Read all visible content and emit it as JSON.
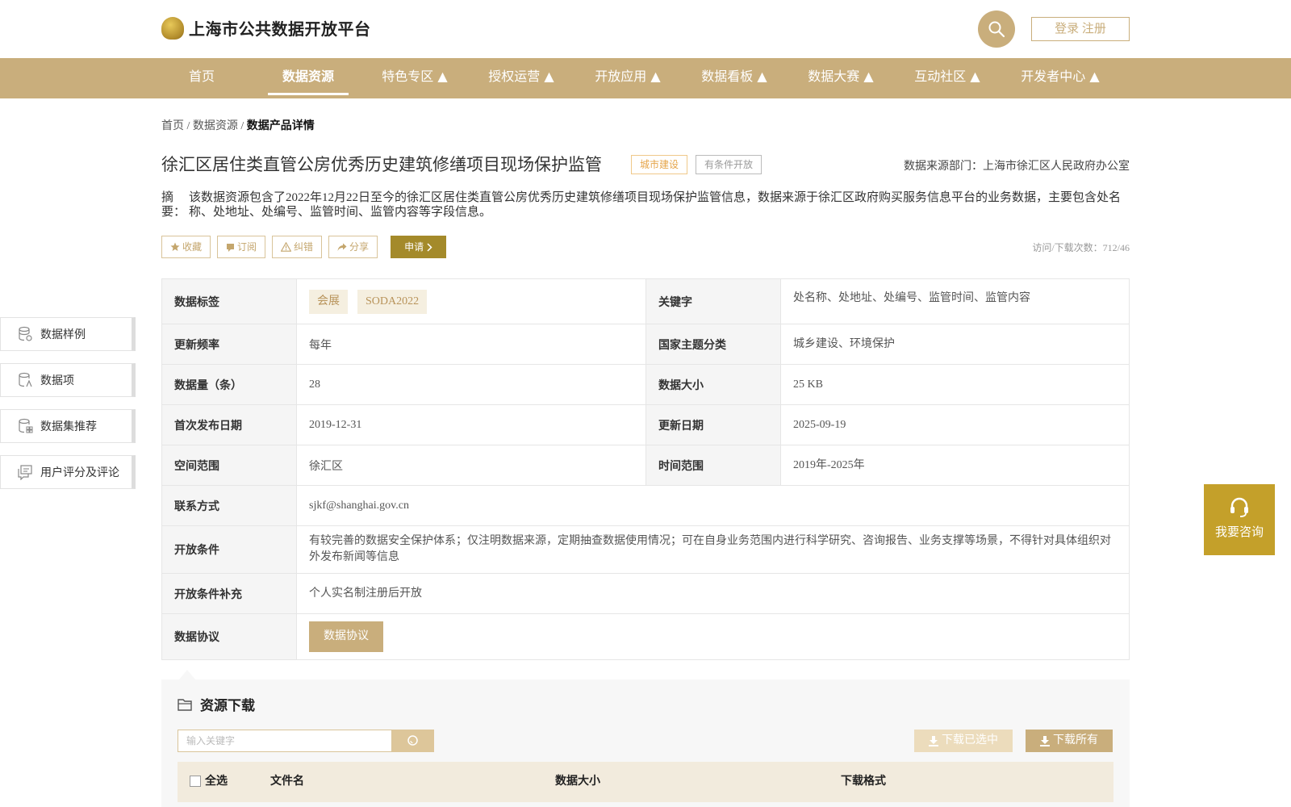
{
  "header": {
    "site_title": "上海市公共数据开放平台",
    "login_label": "登录 注册"
  },
  "nav": {
    "items": [
      {
        "label": "首页"
      },
      {
        "label": "数据资源",
        "active": true
      },
      {
        "label": "特色专区 ▲"
      },
      {
        "label": "授权运营 ▲"
      },
      {
        "label": "开放应用 ▲"
      },
      {
        "label": "数据看板 ▲"
      },
      {
        "label": "数据大赛 ▲"
      },
      {
        "label": "互动社区 ▲"
      },
      {
        "label": "开发者中心 ▲"
      }
    ]
  },
  "breadcrumb": {
    "home": "首页",
    "sep1": " / ",
    "section": "数据资源",
    "sep2": " / ",
    "current": "数据产品详情"
  },
  "dataset": {
    "title": "徐汇区居住类直管公房优秀历史建筑修缮项目现场保护监管",
    "tag_category": "城市建设",
    "tag_access": "有条件开放",
    "source_dept": "数据来源部门：上海市徐汇区人民政府办公室",
    "summary_label": "摘要：",
    "summary_text": "该数据资源包含了2022年12月22日至今的徐汇区居住类直管公房优秀历史建筑修缮项目现场保护监管信息，数据来源于徐汇区政府购买服务信息平台的业务数据，主要包含处名称、处地址、处编号、监管时间、监管内容等字段信息。",
    "visits": "访问/下载次数：712/46"
  },
  "actions": {
    "favorite": "收藏",
    "subscribe": "订阅",
    "report": "纠错",
    "share": "分享",
    "apply": "申请"
  },
  "side_menu": {
    "items": [
      {
        "label": "数据样例"
      },
      {
        "label": "数据项"
      },
      {
        "label": "数据集推荐"
      },
      {
        "label": "用户评分及评论"
      }
    ]
  },
  "info": {
    "tags_label": "数据标签",
    "tags": [
      "会展",
      "SODA2022"
    ],
    "keywords_label": "关键字",
    "keywords": "处名称、处地址、处编号、监管时间、监管内容",
    "freq_label": "更新频率",
    "freq": "每年",
    "theme_label": "国家主题分类",
    "theme": "城乡建设、环境保护",
    "count_label": "数据量（条）",
    "count": "28",
    "size_label": "数据大小",
    "size": "25 KB",
    "first_pub_label": "首次发布日期",
    "first_pub": "2019-12-31",
    "updated_label": "更新日期",
    "updated": "2025-09-19",
    "space_label": "空间范围",
    "space": "徐汇区",
    "time_label": "时间范围",
    "time": "2019年-2025年",
    "contact_label": "联系方式",
    "contact": "sjkf@shanghai.gov.cn",
    "cond_label": "开放条件",
    "cond": "有较完善的数据安全保护体系；仅注明数据来源，定期抽查数据使用情况；可在自身业务范围内进行科学研究、咨询报告、业务支撑等场景，不得针对具体组织对外发布新闻等信息",
    "cond_extra_label": "开放条件补充",
    "cond_extra": "个人实名制注册后开放",
    "agreement_label": "数据协议",
    "agreement_button": "数据协议"
  },
  "consult": {
    "label": "我要咨询"
  },
  "downloads": {
    "title": "资源下载",
    "search_placeholder": "输入关键字",
    "download_selected": "下载已选中",
    "download_all": "下载所有",
    "columns": {
      "select_all": "全选",
      "file_name": "文件名",
      "size": "数据大小",
      "format": "下载格式"
    }
  },
  "colors": {
    "brand": "#c9ae7c",
    "apply": "#a48a2a",
    "consult": "#c4a02a"
  }
}
